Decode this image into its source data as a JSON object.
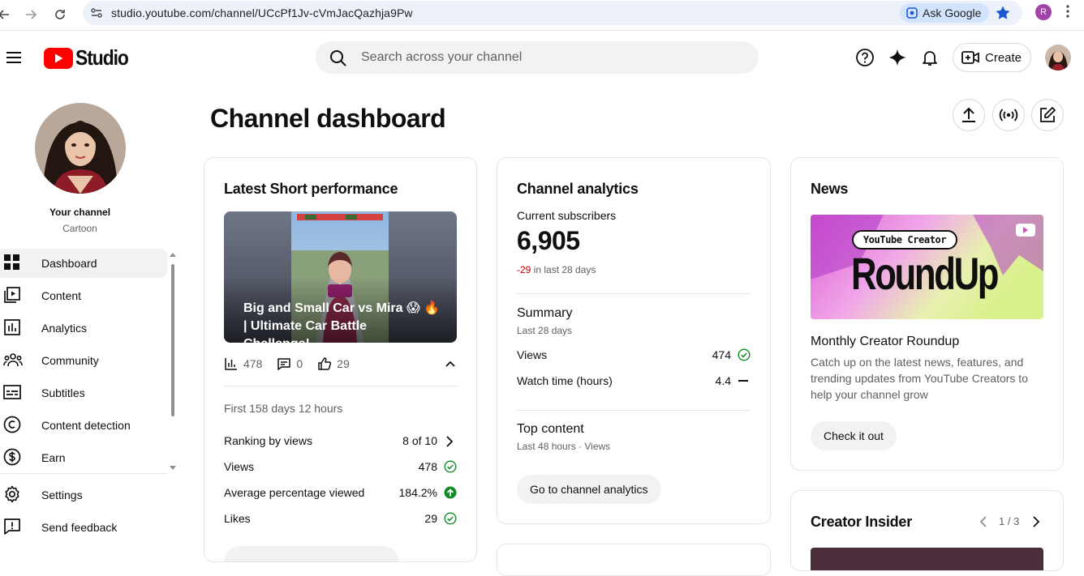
{
  "browser": {
    "url": "studio.youtube.com/channel/UCcPf1Jv-cVmJacQazhja9Pw",
    "ask_google": "Ask Google",
    "profile_initial": "R"
  },
  "header": {
    "logo_text": "Studio",
    "search_placeholder": "Search across your channel",
    "create_label": "Create"
  },
  "sidebar": {
    "channel_label": "Your channel",
    "channel_name": "Cartoon",
    "items": [
      {
        "label": "Dashboard",
        "icon": "dashboard-icon",
        "active": true
      },
      {
        "label": "Content",
        "icon": "content-icon"
      },
      {
        "label": "Analytics",
        "icon": "analytics-icon"
      },
      {
        "label": "Community",
        "icon": "community-icon"
      },
      {
        "label": "Subtitles",
        "icon": "subtitles-icon"
      },
      {
        "label": "Content detection",
        "icon": "copyright-icon"
      },
      {
        "label": "Earn",
        "icon": "dollar-icon"
      }
    ],
    "bottom_items": [
      {
        "label": "Settings",
        "icon": "gear-icon"
      },
      {
        "label": "Send feedback",
        "icon": "feedback-icon"
      }
    ]
  },
  "main": {
    "title": "Channel dashboard"
  },
  "latest_short": {
    "title": "Latest Short performance",
    "video_title": "Big and Small Car vs Mira 😱 🔥 | Ultimate Car Battle Challenge!...",
    "views_count": "478",
    "comments_count": "0",
    "likes_count": "29",
    "period": "First 158 days 12 hours",
    "rows": [
      {
        "label": "Ranking by views",
        "value": "8 of 10"
      },
      {
        "label": "Views",
        "value": "478"
      },
      {
        "label": "Average percentage viewed",
        "value": "184.2%"
      },
      {
        "label": "Likes",
        "value": "29"
      }
    ]
  },
  "analytics": {
    "title": "Channel analytics",
    "subs_label": "Current subscribers",
    "subs_value": "6,905",
    "subs_change": "-29",
    "subs_change_suffix": " in last 28 days",
    "summary_title": "Summary",
    "summary_period": "Last 28 days",
    "summary_rows": [
      {
        "label": "Views",
        "value": "474"
      },
      {
        "label": "Watch time (hours)",
        "value": "4.4"
      }
    ],
    "top_content_title": "Top content",
    "top_content_period": "Last 48 hours · Views",
    "button_label": "Go to channel analytics"
  },
  "news": {
    "title": "News",
    "image_badge": "YouTube Creator",
    "image_headline": "RoundUp",
    "headline": "Monthly Creator Roundup",
    "description": "Catch up on the latest news, features, and trending updates from YouTube Creators to help your channel grow",
    "button_label": "Check it out"
  },
  "creator_insider": {
    "title": "Creator Insider",
    "pager": "1 / 3"
  },
  "colors": {
    "accent_red": "#ff0000",
    "negative": "#cc0000",
    "positive_green": "#0f8a24"
  }
}
